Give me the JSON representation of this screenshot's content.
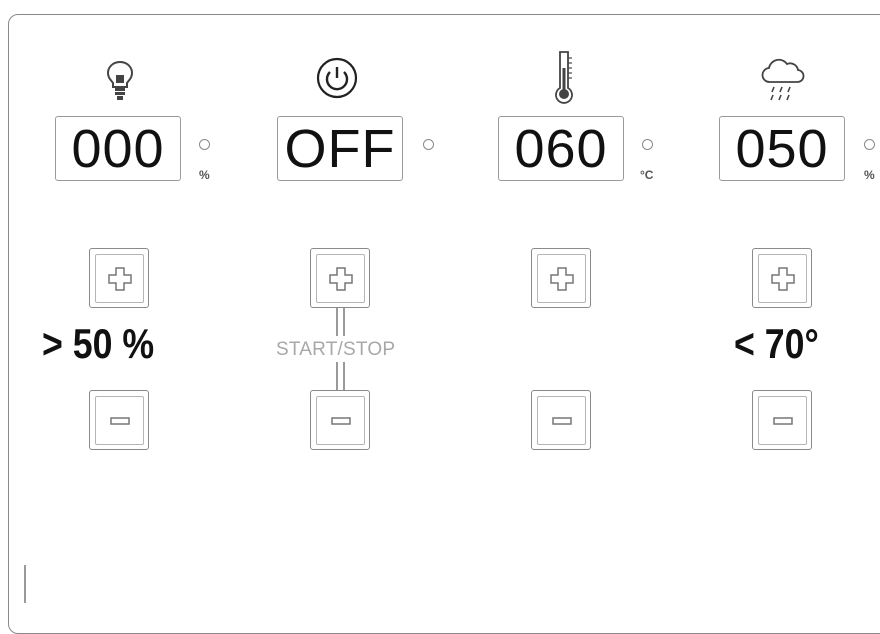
{
  "panel": {
    "light": {
      "display": "000",
      "unit": "%",
      "icon": "lightbulb-icon",
      "label": "> 50 %"
    },
    "power": {
      "display": "OFF",
      "icon": "power-icon",
      "label": "START/STOP"
    },
    "temperature": {
      "display": "060",
      "unit": "°C",
      "icon": "thermometer-icon"
    },
    "humidity": {
      "display": "050",
      "unit": "%",
      "icon": "rain-cloud-icon",
      "label": "< 70°"
    }
  }
}
